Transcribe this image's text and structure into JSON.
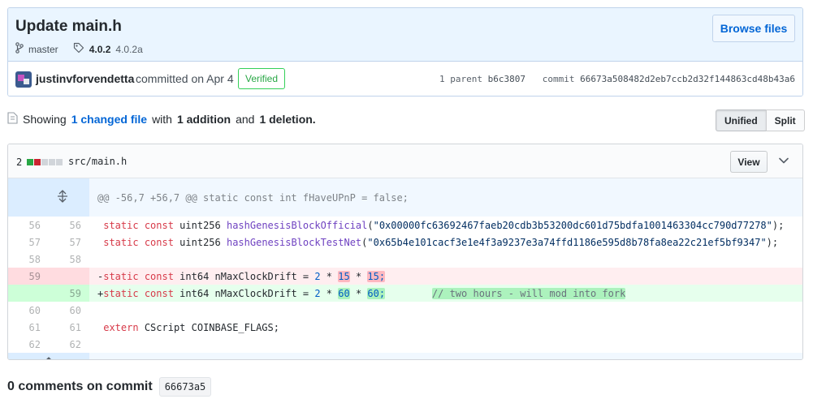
{
  "commit": {
    "title": "Update main.h",
    "browse_label": "Browse files",
    "branch": "master",
    "tags": [
      "4.0.2",
      "4.0.2a"
    ],
    "author": "justinvforvendetta",
    "committed_text": "committed on Apr 4",
    "verified_label": "Verified",
    "parent_label": "1 parent",
    "parent_sha": "b6c3807",
    "commit_label": "commit",
    "commit_sha": "66673a508482d2eb7ccb2d32f144863cd48b43a6"
  },
  "toc": {
    "showing": "Showing",
    "changed_files": "1 changed file",
    "with": "with",
    "additions": "1 addition",
    "and": "and",
    "deletions": "1 deletion.",
    "unified_label": "Unified",
    "split_label": "Split"
  },
  "file": {
    "change_count": "2",
    "path": "src/main.h",
    "view_label": "View",
    "hunk_header": "@@ -56,7 +56,7 @@ static const int fHaveUPnP = false;",
    "lines": [
      {
        "type": "ctx",
        "old": "56",
        "new": "56",
        "code": " static const uint256 hashGenesisBlockOfficial(\"0x00000fc63692467faeb20cdb3b53200dc601d75bdfa1001463304cc790d77278\");"
      },
      {
        "type": "ctx",
        "old": "57",
        "new": "57",
        "code": " static const uint256 hashGenesisBlockTestNet(\"0x65b4e101cacf3e1e4f3a9237e3a74ffd1186e595d8b78fa8ea22c21ef5bf9347\");"
      },
      {
        "type": "ctx",
        "old": "58",
        "new": "58",
        "code": ""
      },
      {
        "type": "del",
        "old": "59",
        "new": "",
        "code": "-static const int64 nMaxClockDrift = 2 * 15 * 15;"
      },
      {
        "type": "add",
        "old": "",
        "new": "59",
        "code": "+static const int64 nMaxClockDrift = 2 * 60 * 60;        // two hours - will mod into fork"
      },
      {
        "type": "ctx",
        "old": "60",
        "new": "60",
        "code": ""
      },
      {
        "type": "ctx",
        "old": "61",
        "new": "61",
        "code": " extern CScript COINBASE_FLAGS;"
      },
      {
        "type": "ctx",
        "old": "62",
        "new": "62",
        "code": ""
      }
    ]
  },
  "comments": {
    "title": "0 comments on commit",
    "sha": "66673a5"
  },
  "colors": {
    "added": "#28a745",
    "deleted": "#cb2431",
    "neutral": "#d1d5da",
    "link": "#0366d6"
  }
}
